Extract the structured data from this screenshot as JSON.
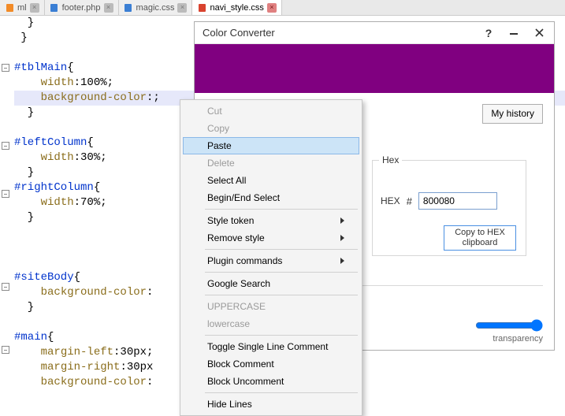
{
  "tabs": [
    {
      "label": "ml",
      "icon_color": "#f28b28"
    },
    {
      "label": "footer.php",
      "icon_color": "#3b7fd4"
    },
    {
      "label": "magic.css",
      "icon_color": "#3b7fd4"
    },
    {
      "label": "navi_style.css",
      "icon_color": "#d9432f"
    }
  ],
  "active_tab_index": 3,
  "code_lines": [
    "  }",
    " }",
    "",
    "#tblMain{",
    "    width:100%;",
    "    background-color:;",
    "  }",
    "",
    "#leftColumn{",
    "    width:30%;",
    "  }",
    "#rightColumn{",
    "    width:70%;",
    "  }",
    "",
    "",
    "",
    "#siteBody{",
    "    background-color:",
    "  }",
    "",
    "#main{",
    "    margin-left:30px;",
    "    margin-right:30px",
    "    background-color:"
  ],
  "fold_lines": [
    3,
    8,
    11,
    17,
    21
  ],
  "highlight_line_index": 5,
  "context_menu": {
    "items": [
      {
        "label": "Cut",
        "disabled": true
      },
      {
        "label": "Copy",
        "disabled": true
      },
      {
        "label": "Paste",
        "hover": true
      },
      {
        "label": "Delete",
        "disabled": true
      },
      {
        "label": "Select All"
      },
      {
        "label": "Begin/End Select"
      },
      {
        "sep": true
      },
      {
        "label": "Style token",
        "submenu": true
      },
      {
        "label": "Remove style",
        "submenu": true
      },
      {
        "sep": true
      },
      {
        "label": "Plugin commands",
        "submenu": true
      },
      {
        "sep": true
      },
      {
        "label": "Google Search"
      },
      {
        "sep": true
      },
      {
        "label": "UPPERCASE",
        "disabled": true
      },
      {
        "label": "lowercase",
        "disabled": true
      },
      {
        "sep": true
      },
      {
        "label": "Toggle Single Line Comment"
      },
      {
        "label": "Block Comment"
      },
      {
        "label": "Block Uncomment"
      },
      {
        "sep": true
      },
      {
        "label": "Hide Lines"
      }
    ]
  },
  "color_converter": {
    "title": "Color Converter",
    "my_history": "My history",
    "hex_group_label": "Hex",
    "hex_label": "HEX",
    "hash": "#",
    "hex_value": "800080",
    "copy_btn": "Copy to HEX clipboard",
    "transparency_label": "transparency",
    "swatch_color": "#800080"
  }
}
